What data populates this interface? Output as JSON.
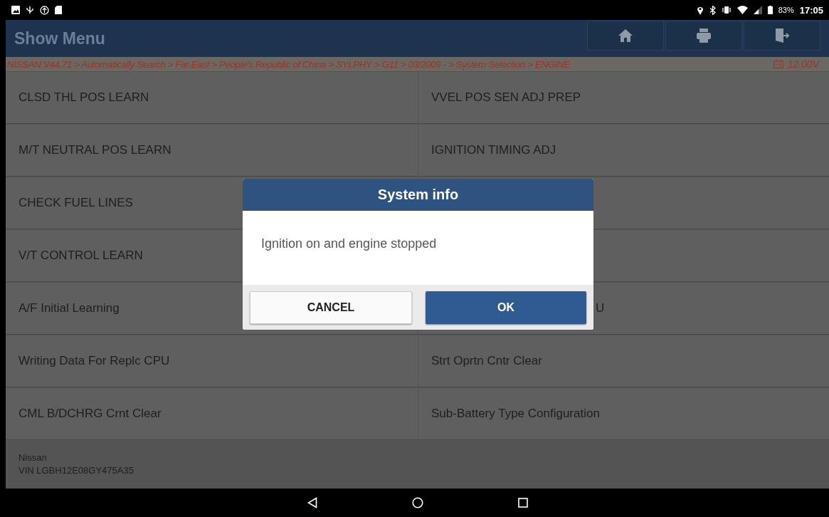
{
  "status_bar": {
    "battery": "83%",
    "time": "17:05"
  },
  "header": {
    "title": "Show Menu"
  },
  "breadcrumb": {
    "path": "NISSAN V44.71 > Automatically Search > Far East > People's Republic of China > SYLPHY > G11 > 03/2009 - > System Selection > ENGINE",
    "voltage": "12.00V"
  },
  "menu_rows": [
    {
      "left": "CLSD THL POS LEARN",
      "right": "VVEL POS SEN ADJ PREP"
    },
    {
      "left": "M/T NEUTRAL POS LEARN",
      "right": "IGNITION TIMING ADJ"
    },
    {
      "left": "CHECK FUEL LINES"
    },
    {
      "left": "V/T CONTROL LEARN"
    },
    {
      "left": "A/F Initial Learning",
      "right": "U",
      "right_partly_hidden": true
    },
    {
      "left": "Writing Data For Replc CPU",
      "right": "Strt Oprtn Cntr Clear"
    },
    {
      "left": "CML B/DCHRG Crnt Clear",
      "right": "Sub-Battery Type Configuration"
    }
  ],
  "footer": {
    "make": "Nissan",
    "vin": "VIN LGBH12E08GY475A35"
  },
  "dialog": {
    "title": "System info",
    "message": "Ignition on and engine stopped",
    "buttons": [
      {
        "label": "CANCEL",
        "kind": "secondary"
      },
      {
        "label": "OK",
        "kind": "primary"
      }
    ]
  }
}
